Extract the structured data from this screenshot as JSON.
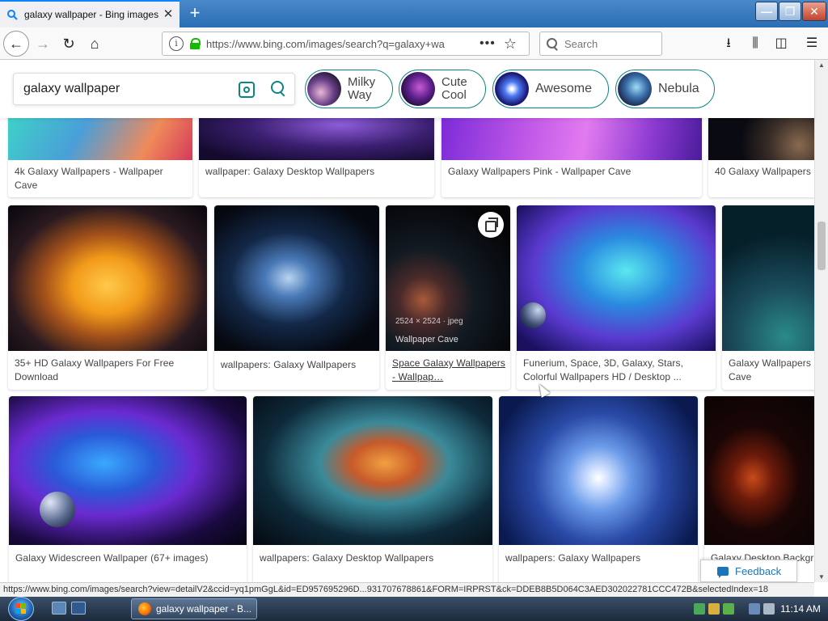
{
  "browser": {
    "tab_title": "galaxy wallpaper - Bing images",
    "url": "https://www.bing.com/images/search?q=galaxy+wa",
    "search_placeholder": "Search",
    "status_url": "https://www.bing.com/images/search?view=detailV2&ccid=yq1pmGgL&id=ED957695296D...931707678861&FORM=IRPRST&ck=DDEB8B5D064C3AED302022781CCC472B&selectedIndex=18"
  },
  "bing": {
    "query": "galaxy wallpaper",
    "chips": [
      {
        "label": "Milky\nWay"
      },
      {
        "label": "Cute\nCool"
      },
      {
        "label": "Awesome"
      },
      {
        "label": "Nebula"
      }
    ],
    "feedback_label": "Feedback"
  },
  "results": {
    "row1": [
      {
        "caption": "4k Galaxy Wallpapers - Wallpaper Cave"
      },
      {
        "caption": "wallpaper: Galaxy Desktop Wallpapers"
      },
      {
        "caption": "Galaxy Wallpapers Pink - Wallpaper Cave"
      },
      {
        "caption": "40 Galaxy Wallpapers"
      }
    ],
    "row2": [
      {
        "caption": "35+ HD Galaxy Wallpapers For Free Download"
      },
      {
        "caption": "wallpapers: Galaxy Wallpapers"
      },
      {
        "caption": "Space Galaxy Wallpapers - Wallpap…",
        "meta": "2524 × 2524 · jpeg",
        "source": "Wallpaper Cave"
      },
      {
        "caption": "Funerium, Space, 3D, Galaxy, Stars, Colorful Wallpapers HD / Desktop ..."
      },
      {
        "caption": "Galaxy Wallpapers Cave"
      }
    ],
    "row3": [
      {
        "caption": "Galaxy Widescreen Wallpaper (67+ images)"
      },
      {
        "caption": "wallpapers: Galaxy Desktop Wallpapers"
      },
      {
        "caption": "wallpapers: Galaxy Wallpapers"
      },
      {
        "caption": "Galaxy Desktop Backgr"
      }
    ]
  },
  "taskbar": {
    "task_label": "galaxy wallpaper - B...",
    "clock": "11:14 AM"
  },
  "colors": {
    "accent": "#0c8484",
    "feedback": "#1b75bb"
  }
}
